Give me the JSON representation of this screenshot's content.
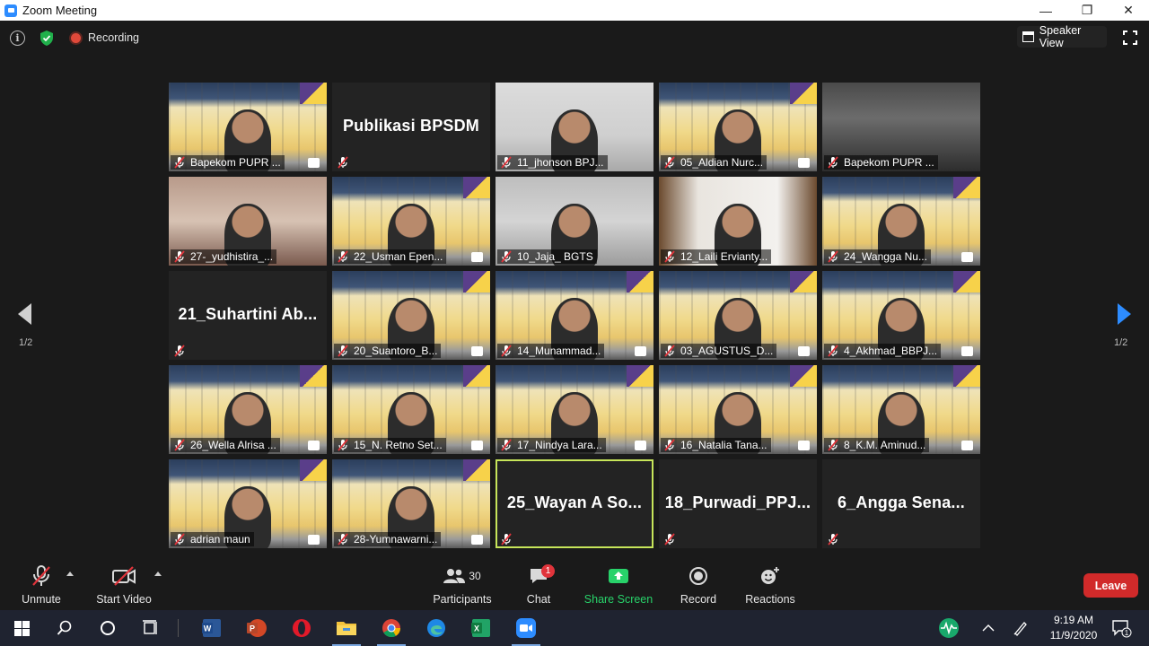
{
  "window": {
    "title": "Zoom Meeting",
    "minimize": "—",
    "restore": "❐",
    "close": "✕"
  },
  "topbar": {
    "info_glyph": "i",
    "recording_label": "Recording",
    "speaker_view_label": "Speaker View"
  },
  "grid": {
    "page_left": "1/2",
    "page_right": "1/2",
    "tiles": [
      {
        "name": "Bapekom PUPR ...",
        "kind": "video",
        "style": "poster"
      },
      {
        "name": "",
        "big": "Publikasi BPSDM",
        "kind": "avatar"
      },
      {
        "name": "11_jhonson BPJ...",
        "kind": "video",
        "style": "room"
      },
      {
        "name": "05_Aldian Nurc...",
        "kind": "video",
        "style": "poster"
      },
      {
        "name": "Bapekom PUPR ...",
        "kind": "video",
        "style": "hall"
      },
      {
        "name": "27-_yudhistira_...",
        "kind": "video",
        "style": "home"
      },
      {
        "name": "22_Usman Epen...",
        "kind": "video",
        "style": "poster"
      },
      {
        "name": "10_Jaja_ BGTS",
        "kind": "video",
        "style": "office"
      },
      {
        "name": "12_Laili Ervianty...",
        "kind": "video",
        "style": "curtain"
      },
      {
        "name": "24_Wangga Nu...",
        "kind": "video",
        "style": "poster"
      },
      {
        "name": "",
        "big": "21_Suhartini  Ab...",
        "kind": "avatar"
      },
      {
        "name": "20_Suantoro_B...",
        "kind": "video",
        "style": "poster"
      },
      {
        "name": "14_Munammad...",
        "kind": "video",
        "style": "poster"
      },
      {
        "name": "03_AGUSTUS_D...",
        "kind": "video",
        "style": "poster"
      },
      {
        "name": "4_Akhmad_BBPJ...",
        "kind": "video",
        "style": "poster"
      },
      {
        "name": "26_Wella Alrisa ...",
        "kind": "video",
        "style": "poster"
      },
      {
        "name": "15_N. Retno Set...",
        "kind": "video",
        "style": "poster"
      },
      {
        "name": "17_Nindya Lara...",
        "kind": "video",
        "style": "poster"
      },
      {
        "name": "16_Natalia Tana...",
        "kind": "video",
        "style": "poster"
      },
      {
        "name": "8_K.M. Aminud...",
        "kind": "video",
        "style": "poster"
      },
      {
        "name": "adrian maun",
        "kind": "video",
        "style": "poster"
      },
      {
        "name": "28-Yumnawarni...",
        "kind": "video",
        "style": "poster"
      },
      {
        "name": "",
        "big": "25_Wayan  A  So...",
        "kind": "avatar",
        "active": true
      },
      {
        "name": "",
        "big": "18_Purwadi_PPJ...",
        "kind": "avatar"
      },
      {
        "name": "",
        "big": "6_Angga  Sena...",
        "kind": "avatar"
      }
    ]
  },
  "toolbar": {
    "unmute": "Unmute",
    "start_video": "Start Video",
    "participants": "Participants",
    "participants_count": "30",
    "chat": "Chat",
    "chat_badge": "1",
    "share_screen": "Share Screen",
    "record": "Record",
    "reactions": "Reactions",
    "leave": "Leave"
  },
  "taskbar": {
    "time": "9:19 AM",
    "date": "11/9/2020",
    "notification_count": "1",
    "apps": [
      "start",
      "search",
      "cortana",
      "task-view",
      "word",
      "powerpoint",
      "opera",
      "file-explorer",
      "chrome",
      "edge",
      "excel",
      "zoom"
    ]
  },
  "colors": {
    "accent_blue": "#2d8cff",
    "share_green": "#28d26a",
    "leave_red": "#d12a2a",
    "recording_red": "#e0493a",
    "active_speaker": "#c7e55a"
  }
}
